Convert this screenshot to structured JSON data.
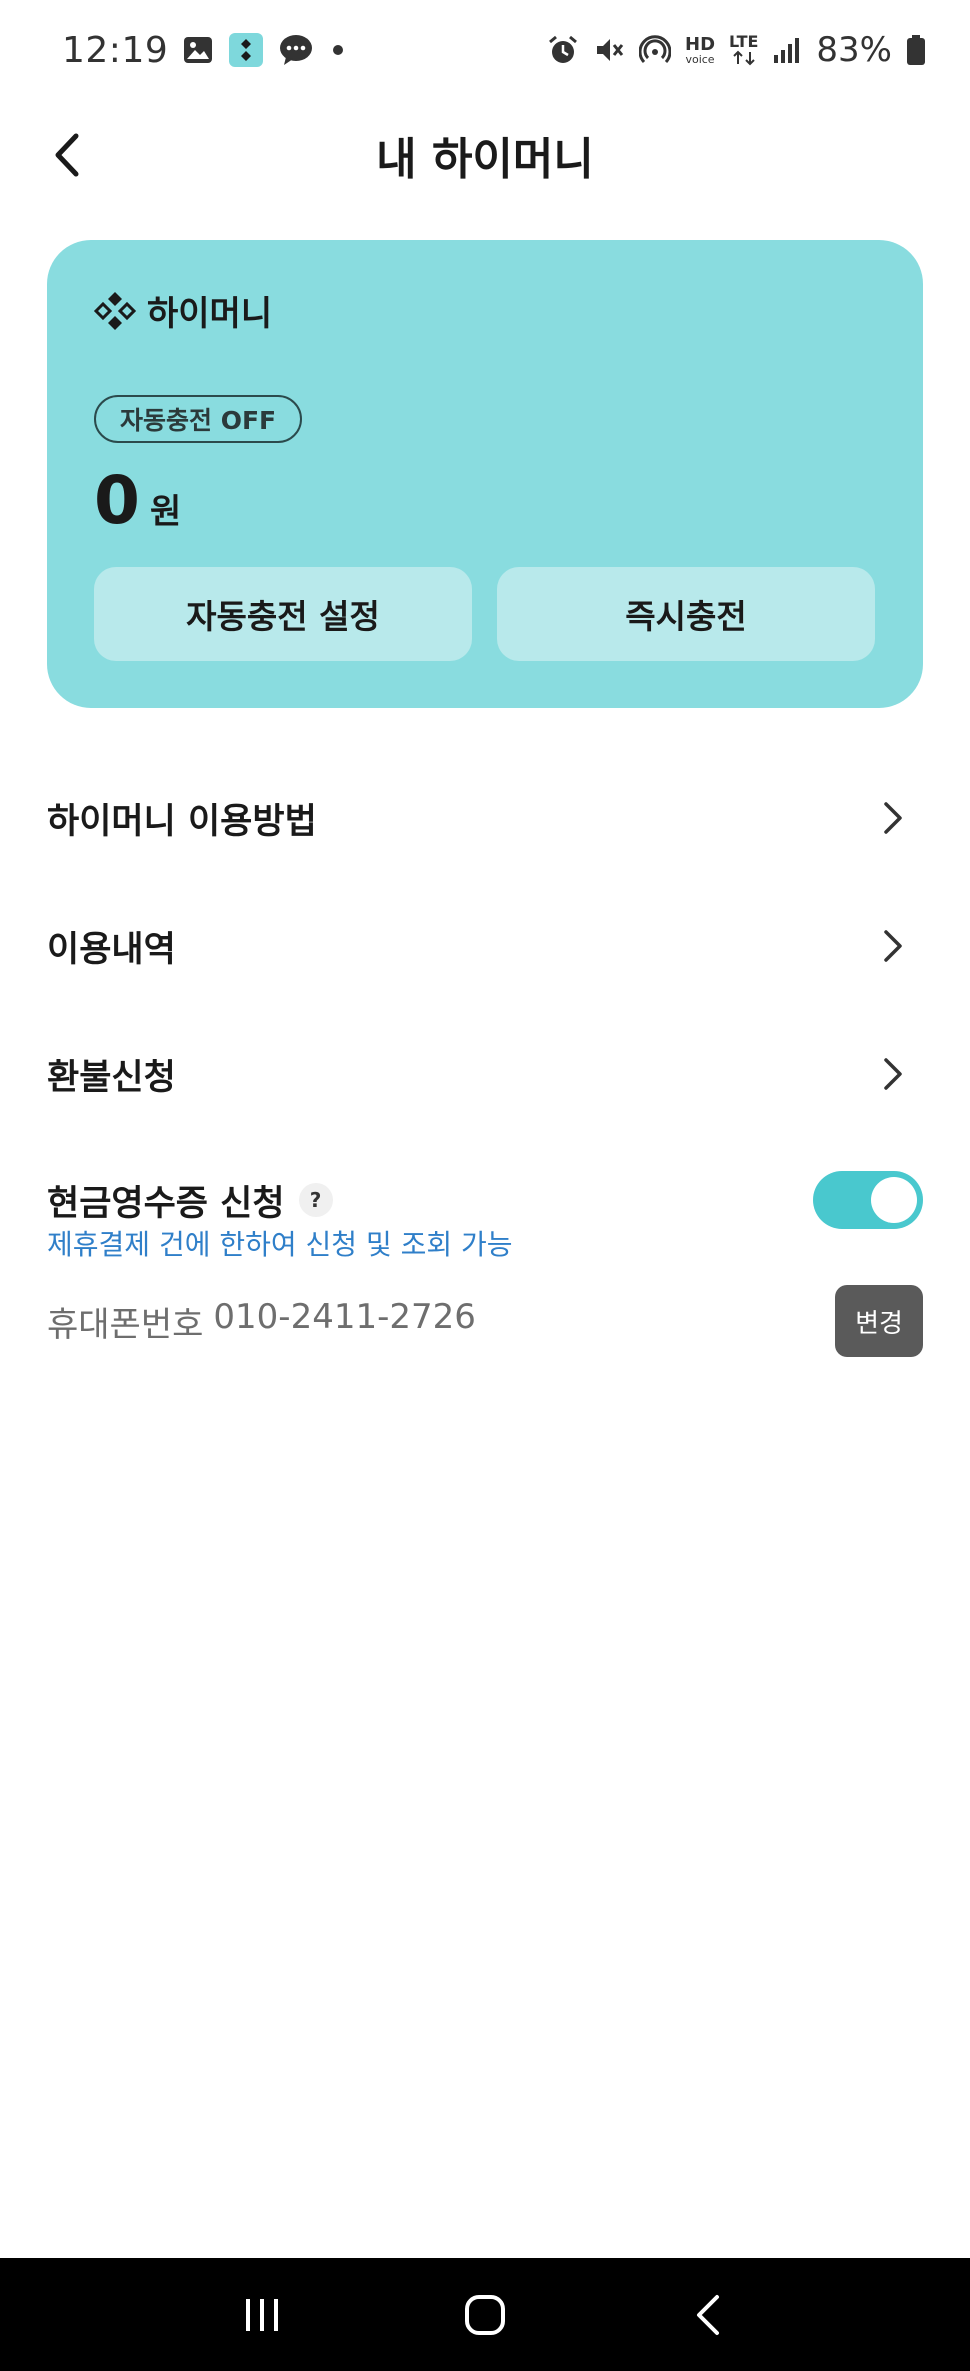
{
  "status_bar": {
    "time": "12:19",
    "battery_text": "83%",
    "icons": [
      "gallery-icon",
      "app-notification-icon",
      "chat-icon",
      "dot-icon",
      "alarm-icon",
      "mute-icon",
      "hotspot-icon",
      "hd-voice-icon",
      "lte-icon",
      "signal-icon",
      "battery-icon"
    ],
    "hd_label": "HD",
    "voice_label": "voice",
    "lte_label": "LTE"
  },
  "header": {
    "title": "내 하이머니"
  },
  "card": {
    "brand_name": "하이머니",
    "auto_charge_badge": "자동충전 OFF",
    "balance_amount": "0",
    "balance_unit": "원",
    "auto_charge_button": "자동충전 설정",
    "instant_charge_button": "즉시충전",
    "background_color": "#89DCDF",
    "button_color": "#B8E9EB"
  },
  "menu": {
    "items": [
      {
        "label": "하이머니 이용방법"
      },
      {
        "label": "이용내역"
      },
      {
        "label": "환불신청"
      }
    ]
  },
  "receipt": {
    "title": "현금영수증 신청",
    "help_glyph": "?",
    "description": "제휴결제 건에 한하여 신청 및 조회 가능",
    "toggle_on": true,
    "toggle_color": "#49C8CE",
    "description_color": "#2F7FC9",
    "phone_label": "휴대폰번호",
    "phone_number": "010-2411-2726",
    "change_button": "변경"
  }
}
